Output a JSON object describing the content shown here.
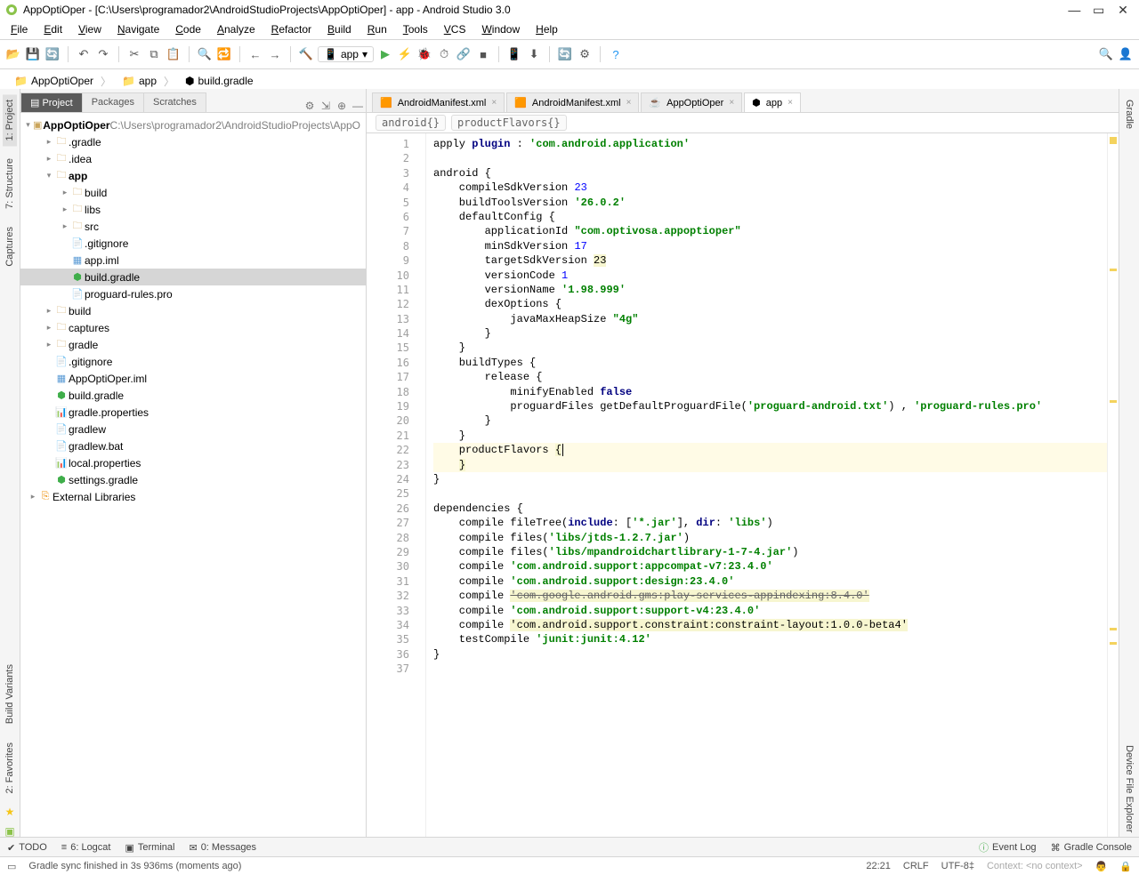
{
  "title": "AppOptiOper - [C:\\Users\\programador2\\AndroidStudioProjects\\AppOptiOper] - app - Android Studio 3.0",
  "menu": [
    "File",
    "Edit",
    "View",
    "Navigate",
    "Code",
    "Analyze",
    "Refactor",
    "Build",
    "Run",
    "Tools",
    "VCS",
    "Window",
    "Help"
  ],
  "run_config": "app",
  "breadcrumbs": [
    "AppOptiOper",
    "app",
    "build.gradle"
  ],
  "project_tabs": {
    "items": [
      "Project",
      "Packages",
      "Scratches"
    ],
    "active": 0
  },
  "left_tabs": [
    "1: Project",
    "7: Structure",
    "Captures"
  ],
  "right_tabs": [
    "Gradle",
    "Device File Explorer"
  ],
  "left_tabs2": [
    "Build Variants",
    "2: Favorites"
  ],
  "tree": {
    "root": {
      "name": "AppOptiOper",
      "path": "C:\\Users\\programador2\\AndroidStudioProjects\\AppO"
    },
    "items": [
      {
        "d": 1,
        "t": "fold",
        "open": false,
        "name": ".gradle",
        "orange": true
      },
      {
        "d": 1,
        "t": "fold",
        "open": false,
        "name": ".idea"
      },
      {
        "d": 1,
        "t": "fold",
        "open": true,
        "name": "app",
        "bold": true
      },
      {
        "d": 2,
        "t": "fold",
        "open": false,
        "name": "build"
      },
      {
        "d": 2,
        "t": "fold",
        "open": false,
        "name": "libs"
      },
      {
        "d": 2,
        "t": "fold",
        "open": false,
        "name": "src"
      },
      {
        "d": 2,
        "t": "file",
        "name": ".gitignore",
        "icon": "txt"
      },
      {
        "d": 2,
        "t": "file",
        "name": "app.iml",
        "icon": "iml"
      },
      {
        "d": 2,
        "t": "file",
        "name": "build.gradle",
        "icon": "gradle",
        "sel": true
      },
      {
        "d": 2,
        "t": "file",
        "name": "proguard-rules.pro",
        "icon": "txt"
      },
      {
        "d": 1,
        "t": "fold",
        "open": false,
        "name": "build"
      },
      {
        "d": 1,
        "t": "fold",
        "open": false,
        "name": "captures"
      },
      {
        "d": 1,
        "t": "fold",
        "open": false,
        "name": "gradle"
      },
      {
        "d": 1,
        "t": "file",
        "name": ".gitignore",
        "icon": "txt"
      },
      {
        "d": 1,
        "t": "file",
        "name": "AppOptiOper.iml",
        "icon": "iml"
      },
      {
        "d": 1,
        "t": "file",
        "name": "build.gradle",
        "icon": "gradle"
      },
      {
        "d": 1,
        "t": "file",
        "name": "gradle.properties",
        "icon": "prop"
      },
      {
        "d": 1,
        "t": "file",
        "name": "gradlew",
        "icon": "txt"
      },
      {
        "d": 1,
        "t": "file",
        "name": "gradlew.bat",
        "icon": "txt"
      },
      {
        "d": 1,
        "t": "file",
        "name": "local.properties",
        "icon": "prop"
      },
      {
        "d": 1,
        "t": "file",
        "name": "settings.gradle",
        "icon": "gradle"
      },
      {
        "d": 0,
        "t": "lib",
        "name": "External Libraries"
      }
    ]
  },
  "editor_tabs": [
    {
      "label": "AndroidManifest.xml",
      "icon": "xml"
    },
    {
      "label": "AndroidManifest.xml",
      "icon": "xml"
    },
    {
      "label": "AppOptiOper",
      "icon": "java"
    },
    {
      "label": "app",
      "icon": "gradle",
      "active": true
    }
  ],
  "scopes": [
    "android{}",
    "productFlavors{}"
  ],
  "code": [
    {
      "n": 1,
      "seg": [
        [
          "",
          "apply "
        ],
        [
          "kw",
          "plugin"
        ],
        [
          "",
          " : "
        ],
        [
          "str",
          "'com.android.application'"
        ]
      ]
    },
    {
      "n": 2,
      "seg": [
        [
          "",
          ""
        ]
      ]
    },
    {
      "n": 3,
      "seg": [
        [
          "",
          "android {"
        ]
      ]
    },
    {
      "n": 4,
      "seg": [
        [
          "",
          "    compileSdkVersion "
        ],
        [
          "num",
          "23"
        ]
      ]
    },
    {
      "n": 5,
      "seg": [
        [
          "",
          "    buildToolsVersion "
        ],
        [
          "str",
          "'26.0.2'"
        ]
      ]
    },
    {
      "n": 6,
      "seg": [
        [
          "",
          "    defaultConfig {"
        ]
      ]
    },
    {
      "n": 7,
      "seg": [
        [
          "",
          "        applicationId "
        ],
        [
          "str",
          "\"com.optivosa.appoptioper\""
        ]
      ]
    },
    {
      "n": 8,
      "seg": [
        [
          "",
          "        minSdkVersion "
        ],
        [
          "num",
          "17"
        ]
      ]
    },
    {
      "n": 9,
      "seg": [
        [
          "",
          "        targetSdkVersion "
        ],
        [
          "hl",
          "23"
        ]
      ]
    },
    {
      "n": 10,
      "seg": [
        [
          "",
          "        versionCode "
        ],
        [
          "num",
          "1"
        ]
      ]
    },
    {
      "n": 11,
      "seg": [
        [
          "",
          "        versionName "
        ],
        [
          "str",
          "'1.98.999'"
        ]
      ]
    },
    {
      "n": 12,
      "seg": [
        [
          "",
          "        dexOptions {"
        ]
      ]
    },
    {
      "n": 13,
      "seg": [
        [
          "",
          "            javaMaxHeapSize "
        ],
        [
          "str",
          "\"4g\""
        ]
      ]
    },
    {
      "n": 14,
      "seg": [
        [
          "",
          "        }"
        ]
      ]
    },
    {
      "n": 15,
      "seg": [
        [
          "",
          "    }"
        ]
      ]
    },
    {
      "n": 16,
      "seg": [
        [
          "",
          "    buildTypes {"
        ]
      ]
    },
    {
      "n": 17,
      "seg": [
        [
          "",
          "        release {"
        ]
      ]
    },
    {
      "n": 18,
      "seg": [
        [
          "",
          "            minifyEnabled "
        ],
        [
          "kw",
          "false"
        ]
      ]
    },
    {
      "n": 19,
      "seg": [
        [
          "",
          "            proguardFiles getDefaultProguardFile("
        ],
        [
          "str",
          "'proguard-android.txt'"
        ],
        [
          "",
          ") , "
        ],
        [
          "str",
          "'proguard-rules.pro'"
        ]
      ]
    },
    {
      "n": 20,
      "seg": [
        [
          "",
          "        }"
        ]
      ]
    },
    {
      "n": 21,
      "seg": [
        [
          "",
          "    }"
        ]
      ]
    },
    {
      "n": 22,
      "cur": true,
      "seg": [
        [
          "",
          "    productFlavors "
        ],
        [
          "hl",
          "{"
        ]
      ]
    },
    {
      "n": 23,
      "cur": true,
      "seg": [
        [
          "",
          "    "
        ],
        [
          "hl",
          "}"
        ]
      ]
    },
    {
      "n": 24,
      "seg": [
        [
          "",
          "}"
        ]
      ]
    },
    {
      "n": 25,
      "seg": [
        [
          "",
          ""
        ]
      ]
    },
    {
      "n": 26,
      "seg": [
        [
          "",
          "dependencies {"
        ]
      ]
    },
    {
      "n": 27,
      "seg": [
        [
          "",
          "    compile fileTree("
        ],
        [
          "kw",
          "include"
        ],
        [
          "",
          ": ["
        ],
        [
          "str",
          "'*.jar'"
        ],
        [
          "",
          ""
        ],
        [
          "",
          "], "
        ],
        [
          "kw",
          "dir"
        ],
        [
          "",
          ": "
        ],
        [
          "str",
          "'libs'"
        ],
        [
          "",
          ""
        ],
        [
          "",
          ")"
        ]
      ]
    },
    {
      "n": 28,
      "seg": [
        [
          "",
          "    compile files("
        ],
        [
          "str",
          "'libs/jtds-1.2.7.jar'"
        ],
        [
          "",
          ""
        ],
        [
          "",
          ")"
        ]
      ]
    },
    {
      "n": 29,
      "seg": [
        [
          "",
          "    compile files("
        ],
        [
          "str",
          "'libs/mpandroidchartlibrary-1-7-4.jar'"
        ],
        [
          "",
          ""
        ],
        [
          "",
          ")"
        ]
      ]
    },
    {
      "n": 30,
      "seg": [
        [
          "",
          "    compile "
        ],
        [
          "str",
          "'com.android.support:appcompat-v7:23.4.0'"
        ]
      ]
    },
    {
      "n": 31,
      "seg": [
        [
          "",
          "    compile "
        ],
        [
          "str",
          "'com.android.support:design:23.4.0'"
        ]
      ]
    },
    {
      "n": 32,
      "seg": [
        [
          "",
          "    compile "
        ],
        [
          "hl strike",
          "'com.google.android.gms:play-services-appindexing:8.4.0'"
        ]
      ]
    },
    {
      "n": 33,
      "seg": [
        [
          "",
          "    compile "
        ],
        [
          "str",
          "'com.android.support:support-v4:23.4.0'"
        ]
      ]
    },
    {
      "n": 34,
      "seg": [
        [
          "",
          "    compile "
        ],
        [
          "hl",
          "'com.android.support.constraint:constraint-layout:1.0.0-beta4'"
        ]
      ]
    },
    {
      "n": 35,
      "seg": [
        [
          "",
          "    testCompile "
        ],
        [
          "str",
          "'junit:junit:4.12'"
        ]
      ]
    },
    {
      "n": 36,
      "seg": [
        [
          "",
          "}"
        ]
      ]
    },
    {
      "n": 37,
      "seg": [
        [
          "",
          ""
        ]
      ]
    }
  ],
  "bottom_tools": [
    "TODO",
    "6: Logcat",
    "Terminal",
    "0: Messages"
  ],
  "bottom_right": [
    "Event Log",
    "Gradle Console"
  ],
  "status": {
    "msg": "Gradle sync finished in 3s 936ms (moments ago)",
    "pos": "22:21",
    "eol": "CRLF",
    "enc": "UTF-8",
    "ctx": "Context: <no context>"
  }
}
